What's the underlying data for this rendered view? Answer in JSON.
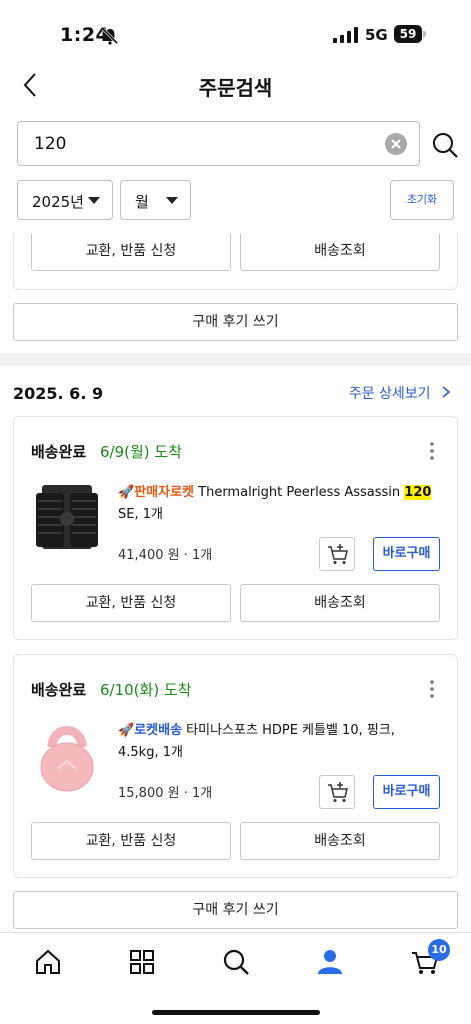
{
  "status_bar": {
    "time": "1:24",
    "network": "5G",
    "battery": "59"
  },
  "header": {
    "title": "주문검색"
  },
  "search": {
    "value": "120",
    "placeholder": ""
  },
  "filters": {
    "year": "2025년",
    "month": "월",
    "reset_label": "초기화"
  },
  "prev_order": {
    "exchange_label": "교환, 반품 신청",
    "tracking_label": "배송조회",
    "review_label": "구매 후기 쓰기"
  },
  "order": {
    "date": "2025. 6. 9",
    "detail_link": "주문 상세보기",
    "cards": [
      {
        "status": "배송완료",
        "arrival": "6/9(월) 도착",
        "badge": "판매자로켓",
        "name_before": "Thermalright Peerless Assassin ",
        "name_highlight": "120",
        "name_after": " SE, 1개",
        "price": "41,400 원 · 1개",
        "buy_label": "바로구매",
        "exchange_label": "교환, 반품 신청",
        "tracking_label": "배송조회",
        "thumb_icon": "cpu-cooler-product-image"
      },
      {
        "status": "배송완료",
        "arrival": "6/10(화) 도착",
        "badge": "로켓배송",
        "name_before": "타미나스포츠 HDPE 케틀벨 10, 핑크, 4.5kg, 1개",
        "name_highlight": "",
        "name_after": "",
        "price": "15,800 원 · 1개",
        "buy_label": "바로구매",
        "exchange_label": "교환, 반품 신청",
        "tracking_label": "배송조회",
        "thumb_icon": "kettlebell-product-image"
      }
    ],
    "review_label": "구매 후기 쓰기"
  },
  "tabbar": {
    "items": [
      "home-icon",
      "category-grid-icon",
      "search-icon",
      "my-account-icon",
      "cart-icon"
    ],
    "cart_count": "10"
  },
  "colors": {
    "accent": "#2a5bd7",
    "arrival": "#1a8a1a",
    "seller_badge": "#e8560f",
    "highlight": "#fff200"
  }
}
